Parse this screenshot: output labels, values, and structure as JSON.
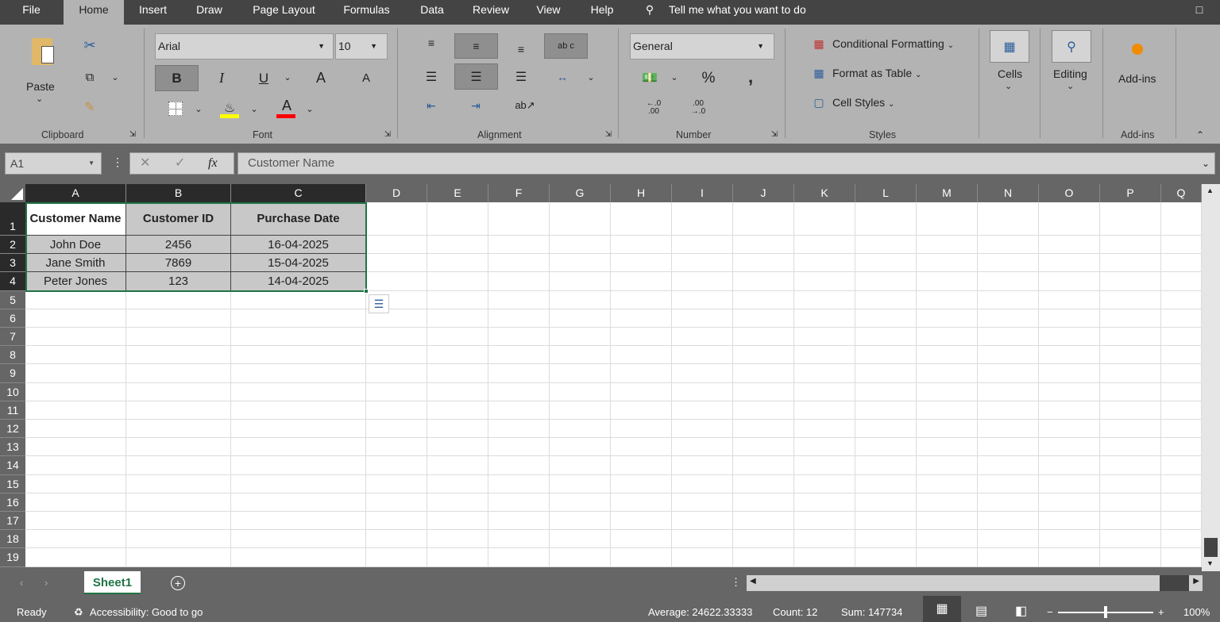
{
  "menu": {
    "tabs": [
      "File",
      "Home",
      "Insert",
      "Draw",
      "Page Layout",
      "Formulas",
      "Data",
      "Review",
      "View",
      "Help"
    ],
    "active": "Home",
    "tell_me": "Tell me what you want to do"
  },
  "ribbon": {
    "clipboard": {
      "paste": "Paste",
      "group": "Clipboard"
    },
    "font": {
      "name": "Arial",
      "size": "10",
      "bold": "B",
      "italic": "I",
      "underline": "U",
      "grow": "A",
      "shrink": "A",
      "font_color": "A",
      "group": "Font",
      "fill_color": "#ffff00",
      "text_color": "#ff0000"
    },
    "alignment": {
      "group": "Alignment",
      "wrap": "ab c"
    },
    "number": {
      "format": "General",
      "percent": "%",
      "comma": ",",
      "inc": "←.0 .00",
      "dec": ".00 →.0",
      "group": "Number"
    },
    "styles": {
      "conditional": "Conditional Formatting",
      "table": "Format as Table",
      "cell_styles": "Cell Styles",
      "group": "Styles"
    },
    "cells": {
      "label": "Cells"
    },
    "editing": {
      "label": "Editing"
    },
    "addins": {
      "label": "Add-ins",
      "group": "Add-ins"
    }
  },
  "formula_bar": {
    "name_box": "A1",
    "fx": "fx",
    "value": "Customer Name"
  },
  "sheet": {
    "columns": [
      "A",
      "B",
      "C",
      "D",
      "E",
      "F",
      "G",
      "H",
      "I",
      "J",
      "K",
      "L",
      "M",
      "N",
      "O",
      "P",
      "Q"
    ],
    "rows": [
      "1",
      "2",
      "3",
      "4",
      "5",
      "6",
      "7",
      "8",
      "9",
      "10",
      "11",
      "12",
      "13",
      "14",
      "15",
      "16",
      "17",
      "18",
      "19"
    ],
    "table": [
      [
        "Customer Name",
        "Customer ID",
        "Purchase Date"
      ],
      [
        "John Doe",
        "2456",
        "16-04-2025"
      ],
      [
        "Jane Smith",
        "7869",
        "15-04-2025"
      ],
      [
        "Peter Jones",
        "123",
        "14-04-2025"
      ]
    ]
  },
  "tabs": {
    "sheets": [
      "Sheet1"
    ],
    "active": "Sheet1"
  },
  "status": {
    "ready": "Ready",
    "accessibility": "Accessibility: Good to go",
    "average": "Average: 24622.33333",
    "count": "Count: 12",
    "sum": "Sum: 147734",
    "zoom": "100%",
    "zoom_level": 100
  }
}
